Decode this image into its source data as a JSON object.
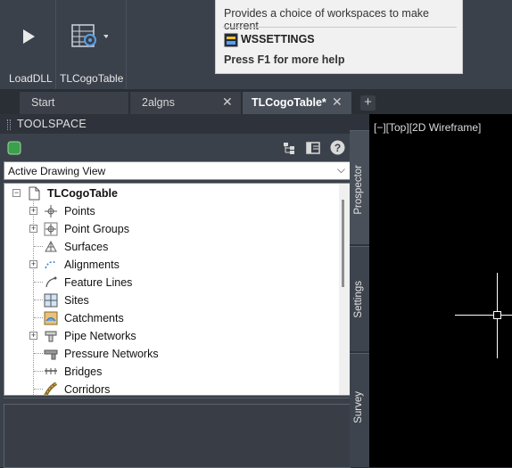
{
  "ribbon": {
    "buttons": [
      {
        "label": "LoadDLL",
        "icon": "play-icon"
      },
      {
        "label": "TLCogoTable",
        "icon": "table-gear-icon"
      }
    ]
  },
  "tooltip": {
    "description": "Provides a choice of workspaces to make current",
    "command": "WSSETTINGS",
    "help": "Press F1 for more help"
  },
  "tabs": [
    {
      "label": "Start",
      "closable": false,
      "active": false
    },
    {
      "label": "2algns",
      "closable": true,
      "active": false
    },
    {
      "label": "TLCogoTable*",
      "closable": true,
      "active": true
    }
  ],
  "new_tab_icon": "plus-icon",
  "toolspace": {
    "title": "TOOLSPACE",
    "view_selector": "Active Drawing View",
    "tree": {
      "root": "TLCogoTable",
      "items": [
        {
          "label": "Points",
          "icon": "points-icon",
          "expandable": true
        },
        {
          "label": "Point Groups",
          "icon": "point-groups-icon",
          "expandable": true
        },
        {
          "label": "Surfaces",
          "icon": "surfaces-icon",
          "expandable": false
        },
        {
          "label": "Alignments",
          "icon": "alignments-icon",
          "expandable": true
        },
        {
          "label": "Feature Lines",
          "icon": "feature-lines-icon",
          "expandable": false
        },
        {
          "label": "Sites",
          "icon": "sites-icon",
          "expandable": false
        },
        {
          "label": "Catchments",
          "icon": "catchments-icon",
          "expandable": false
        },
        {
          "label": "Pipe Networks",
          "icon": "pipe-networks-icon",
          "expandable": true
        },
        {
          "label": "Pressure Networks",
          "icon": "pressure-networks-icon",
          "expandable": false
        },
        {
          "label": "Bridges",
          "icon": "bridges-icon",
          "expandable": false
        },
        {
          "label": "Corridors",
          "icon": "corridors-icon",
          "expandable": false
        }
      ]
    },
    "side_tabs": [
      "Prospector",
      "Settings",
      "Survey"
    ]
  },
  "viewport": {
    "label": "[−][Top][2D Wireframe]"
  },
  "colors": {
    "ribbon_bg": "#3b414b",
    "tooltip_bg": "#f1f1f1",
    "viewport_bg": "#000000",
    "active_tab": "#4a505a"
  }
}
